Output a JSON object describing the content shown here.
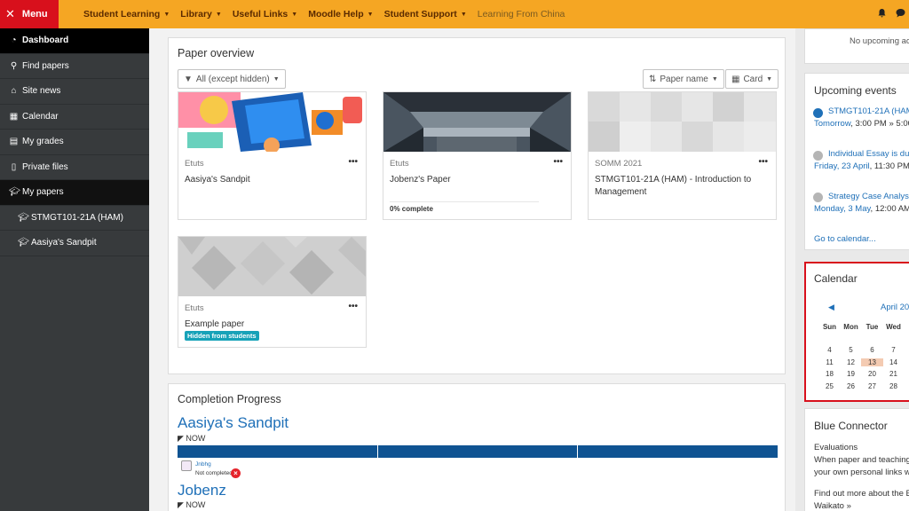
{
  "topbar": {
    "menu_label": "Menu",
    "nav": [
      "Student Learning",
      "Library",
      "Useful Links",
      "Moodle Help",
      "Student Support"
    ],
    "nav_plain": "Learning From China"
  },
  "sidebar": {
    "items": [
      {
        "label": "Dashboard",
        "icon": "dashboard-icon"
      },
      {
        "label": "Find papers",
        "icon": "search-icon"
      },
      {
        "label": "Site news",
        "icon": "home-icon"
      },
      {
        "label": "Calendar",
        "icon": "calendar-icon"
      },
      {
        "label": "My grades",
        "icon": "grades-icon"
      },
      {
        "label": "Private files",
        "icon": "file-icon"
      },
      {
        "label": "My papers",
        "icon": "graduation-cap-icon"
      },
      {
        "label": "STMGT101-21A (HAM)",
        "icon": "graduation-cap-icon"
      },
      {
        "label": "Aasiya's Sandpit",
        "icon": "graduation-cap-icon"
      }
    ]
  },
  "paper_overview": {
    "title": "Paper overview",
    "filter_label": "All (except hidden)",
    "sort_label": "Paper name",
    "view_label": "Card",
    "courses": [
      {
        "category": "Etuts",
        "name": "Aasiya's Sandpit"
      },
      {
        "category": "Etuts",
        "name": "Jobenz's Paper",
        "progress": "0% complete"
      },
      {
        "category": "SOMM 2021",
        "name": "STMGT101-21A (HAM) - Introduction to Management"
      },
      {
        "category": "Etuts",
        "name": "Example paper",
        "badge": "Hidden from students"
      }
    ]
  },
  "completion": {
    "title": "Completion Progress",
    "courses": [
      {
        "name": "Aasiya's Sandpit",
        "now": "NOW",
        "activity": "Jnbhg",
        "status": "Not completed"
      },
      {
        "name": "Jobenz",
        "now": "NOW"
      }
    ]
  },
  "right": {
    "top_text": "No upcoming ac",
    "upcoming": {
      "title": "Upcoming events",
      "events": [
        {
          "title": "STMGT101-21A (HAM",
          "date": "Tomorrow, 3:00 PM » 5:00",
          "date_link": "Tomorrow"
        },
        {
          "title": "Individual Essay is du",
          "date": "Friday, 23 April, 11:30 PM",
          "date_link": "Friday, 23 April"
        },
        {
          "title": "Strategy Case Analys",
          "date": "Monday, 3 May, 12:00 AM",
          "date_link": "Monday, 3 May"
        }
      ],
      "go_link": "Go to calendar..."
    },
    "calendar": {
      "title": "Calendar",
      "month": "April 20",
      "days": [
        "Sun",
        "Mon",
        "Tue",
        "Wed"
      ],
      "rows": [
        [
          "4",
          "5",
          "6",
          "7"
        ],
        [
          "11",
          "12",
          "13",
          "14"
        ],
        [
          "18",
          "19",
          "20",
          "21"
        ],
        [
          "25",
          "26",
          "27",
          "28"
        ]
      ],
      "today": "13"
    },
    "blue_connector": {
      "title": "Blue Connector",
      "line1": "Evaluations",
      "line2": "When paper and teaching",
      "line3": "your own personal links w",
      "line4": "Find out more about the E",
      "line5": "Waikato »"
    }
  },
  "colors": {
    "topbar": "#f5a623",
    "menu": "#d8101c",
    "sidebar": "#373a3c",
    "link": "#1f70b8",
    "progress_bar": "#0f5392",
    "badge": "#17a2b8"
  }
}
